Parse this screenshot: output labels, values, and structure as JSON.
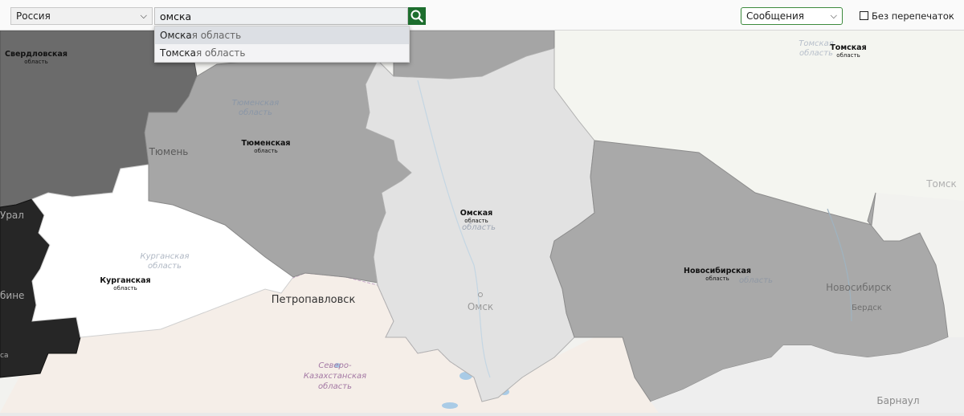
{
  "toolbar": {
    "country": "Россия",
    "search_value": "омска",
    "layer": "Сообщения",
    "reprint_label": "Без перепечаток"
  },
  "suggestions": [
    {
      "match": "Омска",
      "rest": "я область"
    },
    {
      "match": "Томска",
      "rest": "я область"
    }
  ],
  "map": {
    "regions": [
      {
        "name": "Свердловская",
        "sub": "область"
      },
      {
        "name": "Тюменская",
        "sub": "область"
      },
      {
        "name": "Омская",
        "sub": "область"
      },
      {
        "name": "Новосибирская",
        "sub": "область"
      },
      {
        "name": "Курганская",
        "sub": "область"
      },
      {
        "name": "Томская",
        "sub": "область"
      }
    ],
    "base_labels": {
      "tyumen_region": "Тюменская",
      "tyumen_region_sub": "область",
      "tyumen_city": "Тюмень",
      "omsk_region_sub": "область",
      "omsk_city": "Омск",
      "novosibirsk_region_sub": "область",
      "novosibirsk_city": "Новосибирск",
      "berdsk": "Бердск",
      "kurgan_region": "Курганская",
      "kurgan_region_sub": "область",
      "tomsk_region": "Томская",
      "tomsk_region_sub": "область",
      "tomsk_city": "Томск",
      "petropavlovsk": "Петропавловск",
      "nkz_1": "Северо-",
      "nkz_2": "Казахстанская",
      "nkz_3": "область",
      "barnaul": "Барнаул",
      "ural_frag": "Урал",
      "bin_frag": "бине",
      "sa_frag": "са"
    }
  }
}
